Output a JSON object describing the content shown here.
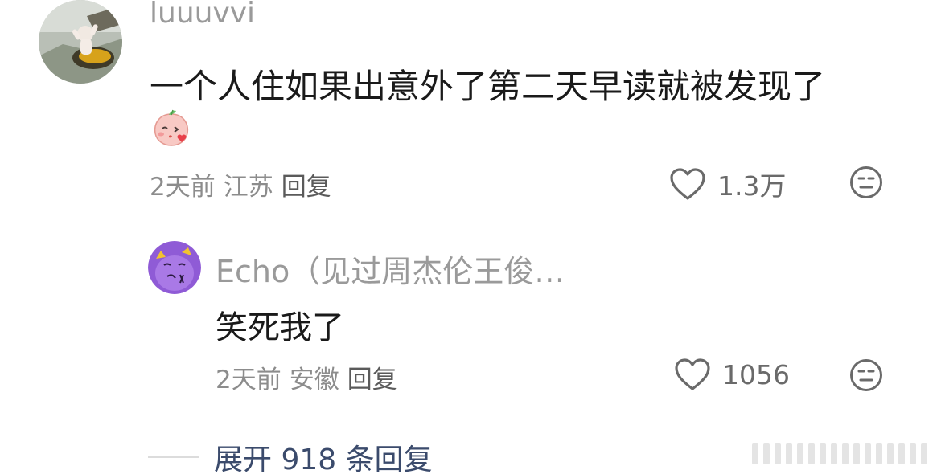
{
  "comments": [
    {
      "username": "luuuvvi",
      "text": "一个人住如果出意外了第二天早读就被发现了",
      "emoji": "peach-kiss-emoji",
      "time": "2天前",
      "location": "江苏",
      "reply_label": "回复",
      "likes": "1.3万"
    }
  ],
  "replies": [
    {
      "username": "Echo（见过周杰伦王俊…",
      "text": "笑死我了",
      "time": "2天前",
      "location": "安徽",
      "reply_label": "回复",
      "likes": "1056"
    }
  ],
  "expand": {
    "label": "展开 918 条回复"
  },
  "icons": {
    "like": "heart-outline-icon",
    "dislike": "meh-face-icon"
  },
  "colors": {
    "username": "#9a9a9a",
    "text": "#1a1a1a",
    "meta": "#8c8c8c",
    "expand_link": "#3b4b6c"
  }
}
